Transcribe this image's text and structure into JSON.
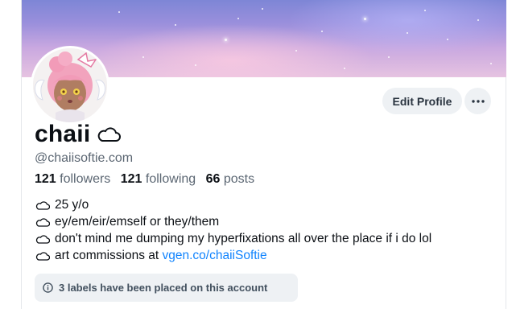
{
  "profile": {
    "display_name": "chaii",
    "handle": "@chaiisoftie.com",
    "avatar_icon": "avatar-image"
  },
  "actions": {
    "edit_profile_label": "Edit Profile",
    "more_icon": "ellipsis-icon"
  },
  "stats": {
    "followers_count": "121",
    "followers_label": "followers",
    "following_count": "121",
    "following_label": "following",
    "posts_count": "66",
    "posts_label": "posts"
  },
  "bio": {
    "icon": "cloud-icon",
    "line1": "25 y/o",
    "line2": "ey/em/eir/emself or they/them",
    "line3": "don't mind me dumping my hyperfixations all over the place if i do lol",
    "line4_prefix": "art commissions at ",
    "line4_link": "vgen.co/chaiiSoftie"
  },
  "labels_notice": {
    "icon": "info-icon",
    "text": "3 labels have been placed on this account"
  },
  "colors": {
    "link": "#1083fe",
    "muted_text": "#5b6672",
    "button_bg": "#eef1f4"
  }
}
